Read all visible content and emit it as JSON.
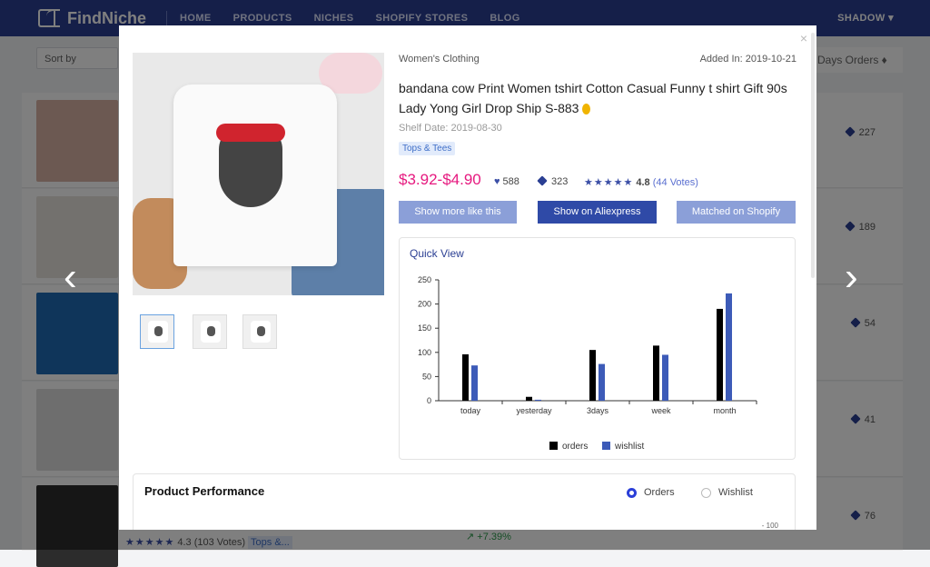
{
  "brand": {
    "name": "FindNiche"
  },
  "nav": {
    "items": [
      "HOME",
      "PRODUCTS",
      "NICHES",
      "SHOPIFY STORES",
      "BLOG"
    ],
    "user": "SHADOW ▾"
  },
  "background": {
    "sort_label": "Sort by",
    "days_orders": "Days Orders ♦",
    "rows": [
      {
        "count": "227"
      },
      {
        "count": "189"
      },
      {
        "count": "54"
      },
      {
        "count": "41"
      },
      {
        "count": "76"
      }
    ],
    "bottom_rating": "4.3 (103 Votes)",
    "bottom_stars": "★★★★★",
    "bottom_tag": "Tops &...",
    "bottom_pct": "↗ +7.39%"
  },
  "modal": {
    "close": "×",
    "category": "Women's Clothing",
    "added": "Added In: 2019-10-21",
    "title": "bandana cow Print Women tshirt Cotton Casual Funny t shirt Gift 90s Lady Yong Girl Drop Ship S-883",
    "shelf_date": "Shelf Date: 2019-08-30",
    "tag": "Tops & Tees",
    "price": "$3.92-$4.90",
    "likes": "588",
    "tags_count": "323",
    "stars": "★★★★★",
    "rating": "4.8",
    "votes": "(44 Votes)",
    "buttons": {
      "more": "Show more like this",
      "aliexpress": "Show on Aliexpress",
      "shopify": "Matched on Shopify"
    },
    "quick_view": "Quick View",
    "performance": {
      "title": "Product Performance",
      "option_orders": "Orders",
      "option_wishlist": "Wishlist",
      "axis_top": "- 100"
    }
  },
  "arrows": {
    "left": "‹",
    "right": "›"
  },
  "chart_data": {
    "type": "bar",
    "categories": [
      "today",
      "yesterday",
      "3days",
      "week",
      "month"
    ],
    "series": [
      {
        "name": "orders",
        "values": [
          96,
          8,
          105,
          114,
          190
        ],
        "color": "#000000"
      },
      {
        "name": "wishlist",
        "values": [
          73,
          2,
          76,
          95,
          222
        ],
        "color": "#3d5bb8"
      }
    ],
    "ylim": [
      0,
      250
    ],
    "yticks": [
      0,
      50,
      100,
      150,
      200,
      250
    ],
    "legend": "bottom"
  }
}
